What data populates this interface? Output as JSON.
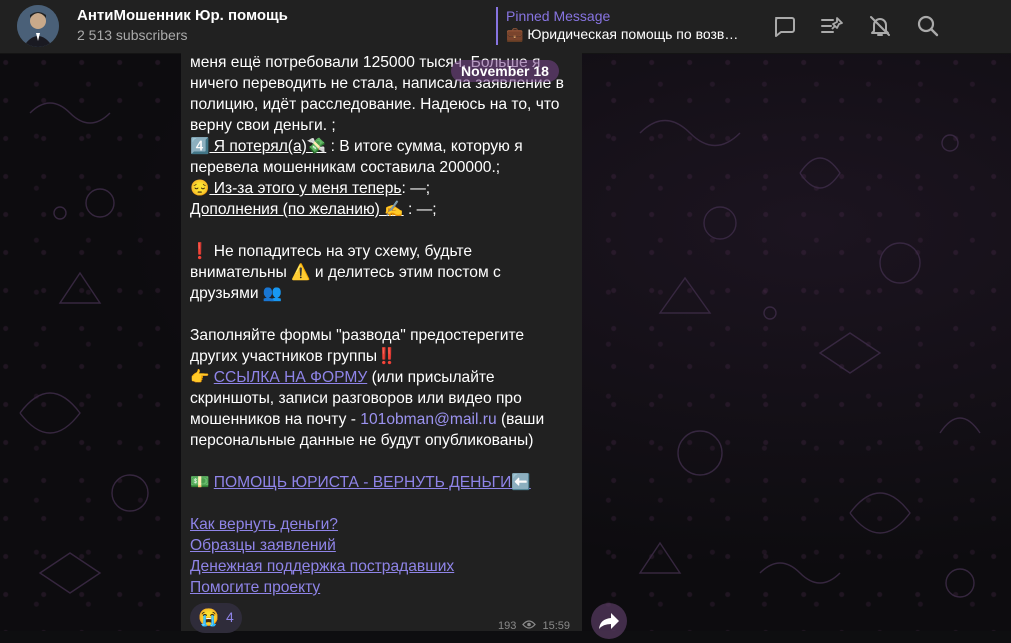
{
  "header": {
    "channel_title": "АнтиМошенник Юр. помощь",
    "subscribers": "2 513 subscribers",
    "pinned_label": "Pinned Message",
    "pinned_text": "💼 Юридическая помощь по возв…"
  },
  "icons": {
    "avatar": "channel-avatar",
    "comments": "comment-icon",
    "pin": "pin-list-icon",
    "mute": "bell-off-icon",
    "search": "search-icon",
    "share": "share-arrow-icon"
  },
  "date_pill": "November 18",
  "message": {
    "line1": "меня ещё потребовали 125000 тысяч. Больше я ничего переводить не стала, написала заявление в полицию, идёт расследование. Надеюсь на то, что верну свои деньги. ;",
    "q4_prefix": "4️⃣",
    "q4_label": " Я потерял(а)💸",
    "q4_text": " : В итоге сумма, которую я перевела мошенникам составила 200000.;",
    "q5_prefix": "😔",
    "q5_label": " Из-за этого у меня теперь",
    "q5_text": ": —;",
    "q6_label": "Дополнения (по желанию) ✍️",
    "q6_text": " : —;",
    "warning": "❗️ Не попадитесь на эту схему, будьте внимательны ⚠️  и делитесь этим постом с друзьями 👥",
    "forms_text": "Заполняйте формы \"развода\" предостерегите других участников группы‼️",
    "point": "👉 ",
    "form_link": "ССЫЛКА НА ФОРМУ",
    "form_rest_1": " (или присылайте скриншоты, записи разговоров или видео про мошенников на почту - ",
    "email": "101obman@mail.ru",
    "form_rest_2": " (ваши персональные данные не будут опубликованы)",
    "money_icon": "💵 ",
    "lawyer_link": "ПОМОЩЬ ЮРИСТА - ВЕРНУТЬ ДЕНЬГИ⬅️",
    "links": [
      "Как вернуть деньги?",
      "Образцы заявлений",
      "Денежная поддержка пострадавших",
      "Помогите проекту"
    ]
  },
  "reaction": {
    "emoji": "😭",
    "count": "4"
  },
  "meta": {
    "views": "193",
    "time": "15:59"
  },
  "colors": {
    "accent": "#8774e1",
    "link": "#8f84e8",
    "bubble": "#212121",
    "header": "#212121"
  }
}
